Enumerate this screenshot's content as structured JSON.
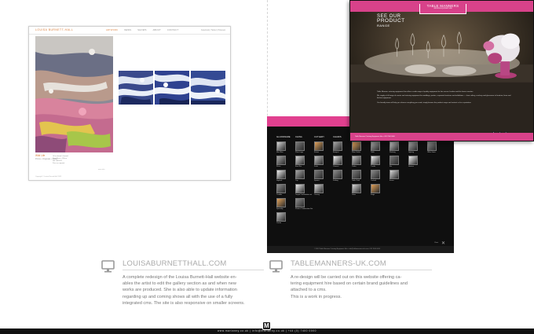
{
  "left_project": {
    "title": "LOUISABURNETTHALL.COM",
    "description_lines": [
      "A complete redesign of the Louisa Burnett-Hall website en-",
      "ables the artist to edit the gallery section as and when new",
      "works are produced. She is also able to update information",
      "regarding up and coming shows all with the use of a fully",
      "integrated cms. The site is also responsive on smaller screens."
    ],
    "site": {
      "logo": "LOUISA BURNETT-HALL",
      "menu": [
        "ARTWORK",
        "NEWS",
        "SHOWS",
        "ABOUT",
        "CONTACT"
      ],
      "social": "Facebook | Twitter | Pinterest",
      "caption_title": "Wild Life",
      "caption_sub": "Prints • Originals • Cards",
      "details": [
        "Oil on board • framed",
        "Size 75cm x 110cm",
        "Ref: lbh0141",
        "Price on request"
      ],
      "more": "more info",
      "footer": "Copyright © Louisa Burnett-Hall 2013"
    }
  },
  "right_project": {
    "title": "TABLEMANNERS-UK.COM",
    "description_lines": [
      "A re-design will be carried out on this website offering ca-",
      "tering equipment hire based on certain brand guidelines and",
      "attached to a cms.",
      "This is a work in progress."
    ],
    "site": {
      "brand": "TABLE MANNERS",
      "brand_sub": "CATERING EQUIPMENT HIRE",
      "heading_1": "SEE OUR",
      "heading_2": "PRODUCT",
      "heading_3": "RANGE",
      "copy": [
        "Table Manners catering equipment hire offers a wide range of quality equipment for hire across London and the home counties.",
        "We supply a full range of events and catering equipment for weddings, parties, corporate functions and exhibitions — from cutlery, crockery and glassware to furniture, linen and kitchen equipment.",
        "Our friendly team will help you choose everything you need; simply browse the product range and contact us for a quotation."
      ],
      "categories": [
        "GLASSWARE",
        "CHINA",
        "CUTLERY",
        "CHAIRS",
        "LINEN"
      ],
      "column_items": [
        [
          "Hire Wine",
          "Flutes",
          "Highball",
          "Tumbler",
          "Speciality",
          "Carafe"
        ],
        [
          "Plate Large",
          "Bowl Sm",
          "Cup",
          "Teapot Combination set",
          "Platters Combination Set"
        ],
        [
          "Knives",
          "Forks",
          "Spoons",
          "Carving"
        ],
        [
          "Banquet",
          "Chiavari",
          "Folding"
        ],
        [
          "Wine Cooler",
          "Cloths",
          "Table Cloth",
          "Other"
        ]
      ],
      "extra_items": [
        [
          "Table",
          "Trestle",
          "Cocktail",
          "Stage"
        ],
        [
          "Shelving",
          "Bar",
          "Extras"
        ],
        [
          "Lighting",
          "Heaters"
        ],
        [
          "Office Items"
        ]
      ],
      "close_label": "Close",
      "back_footer": "© 2013 Table Manners Catering Equipment Hire • info@tablemanners-uk.com • 020 7000 0000",
      "front_footer": "Table Manners Catering Equipment Hire • 020 7000 0000"
    }
  },
  "bottom_bar": {
    "text": "www.marianny.co.uk | info@marianny.co.uk | +44 (0) 7400 0000",
    "logo_letter": "M"
  },
  "colors": {
    "accent_orange": "#d97a34",
    "tm_pink": "#d8428a",
    "text_grey": "#777777",
    "title_grey": "#aaaaaa"
  },
  "icons": [
    "monitor-icon",
    "close-icon",
    "facebook-icon",
    "twitter-icon",
    "pinterest-icon"
  ]
}
